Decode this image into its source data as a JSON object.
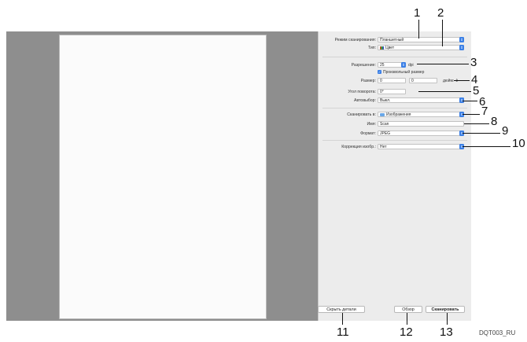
{
  "settings": {
    "scan_mode": {
      "label": "Режим сканирования:",
      "value": "Планшетный"
    },
    "type": {
      "label": "Тип:",
      "value": "Цвет"
    },
    "resolution": {
      "label": "Разрешение:",
      "value": "25",
      "unit": "dpi"
    },
    "custom_size": {
      "label": "Произвольный размер",
      "checked": true
    },
    "size": {
      "label": "Размер:",
      "width": "0",
      "height": "0",
      "unit": "дюйм"
    },
    "rotation": {
      "label": "Угол поворота:",
      "value": "0°"
    },
    "auto_select": {
      "label": "Автовыбор:",
      "value": "Выкл."
    },
    "scan_to": {
      "label": "Сканировать в:",
      "value": "Изображения"
    },
    "name": {
      "label": "Имя:",
      "value": "Scan"
    },
    "format": {
      "label": "Формат:",
      "value": "JPEG"
    },
    "correction": {
      "label": "Коррекция изобр.:",
      "value": "Нет"
    }
  },
  "buttons": {
    "hide_details": "Скрыть детали",
    "browse": "Обзор",
    "scan": "Сканировать"
  },
  "callouts": [
    "1",
    "2",
    "3",
    "4",
    "5",
    "6",
    "7",
    "8",
    "9",
    "10",
    "11",
    "12",
    "13"
  ],
  "doc_code": "DQT003_RU",
  "colors": {
    "accent": "#3a7fe6",
    "preview_bg": "#8e8e8e",
    "panel_bg": "#ececec"
  }
}
